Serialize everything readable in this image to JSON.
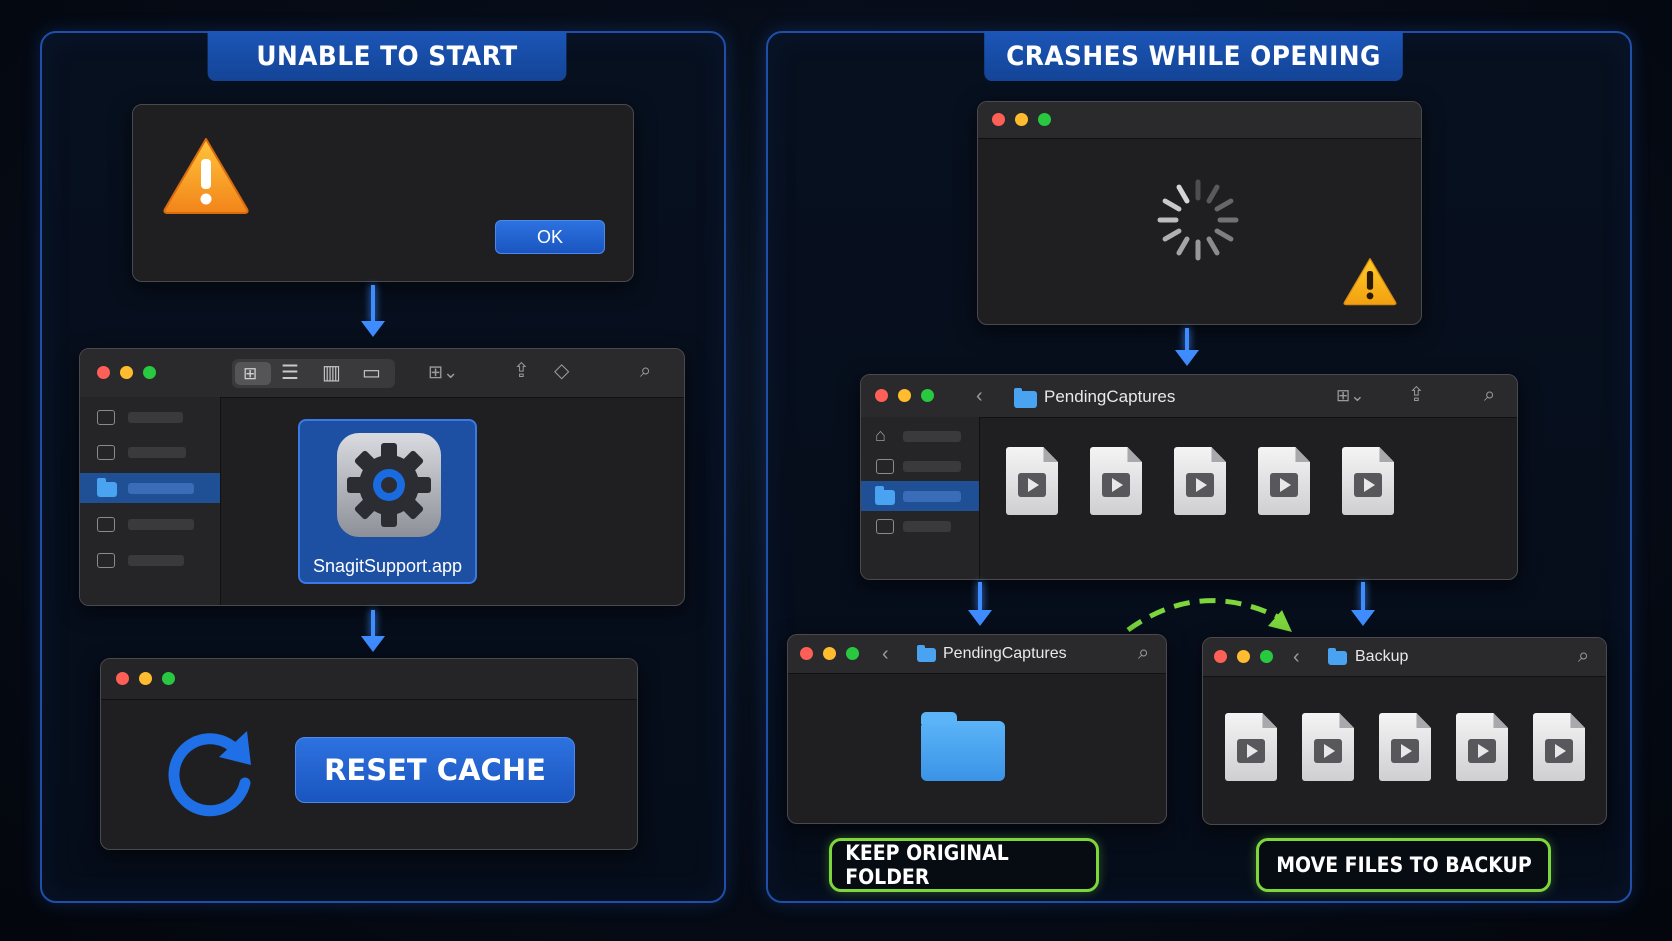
{
  "left_panel": {
    "title": "UNABLE TO START",
    "dialog": {
      "ok_label": "OK"
    },
    "finder": {
      "app_name": "SnagitSupport.app"
    },
    "reset": {
      "button_label": "RESET CACHE"
    }
  },
  "right_panel": {
    "title": "CRASHES WHILE OPENING",
    "finder": {
      "folder_name": "PendingCaptures",
      "file_count": 5
    },
    "left_window": {
      "folder_name": "PendingCaptures"
    },
    "right_window": {
      "folder_name": "Backup",
      "file_count": 5
    },
    "labels": {
      "keep": "KEEP ORIGINAL FOLDER",
      "move": "MOVE FILES TO BACKUP"
    }
  },
  "colors": {
    "accent_blue": "#1c56b8",
    "arrow_blue": "#3f8cff",
    "action_green": "#7cd63c",
    "warning_orange": "#f59a1c"
  },
  "icons": [
    "warning-icon",
    "gear-icon",
    "refresh-icon",
    "spinner-icon",
    "video-file-icon",
    "folder-icon"
  ]
}
